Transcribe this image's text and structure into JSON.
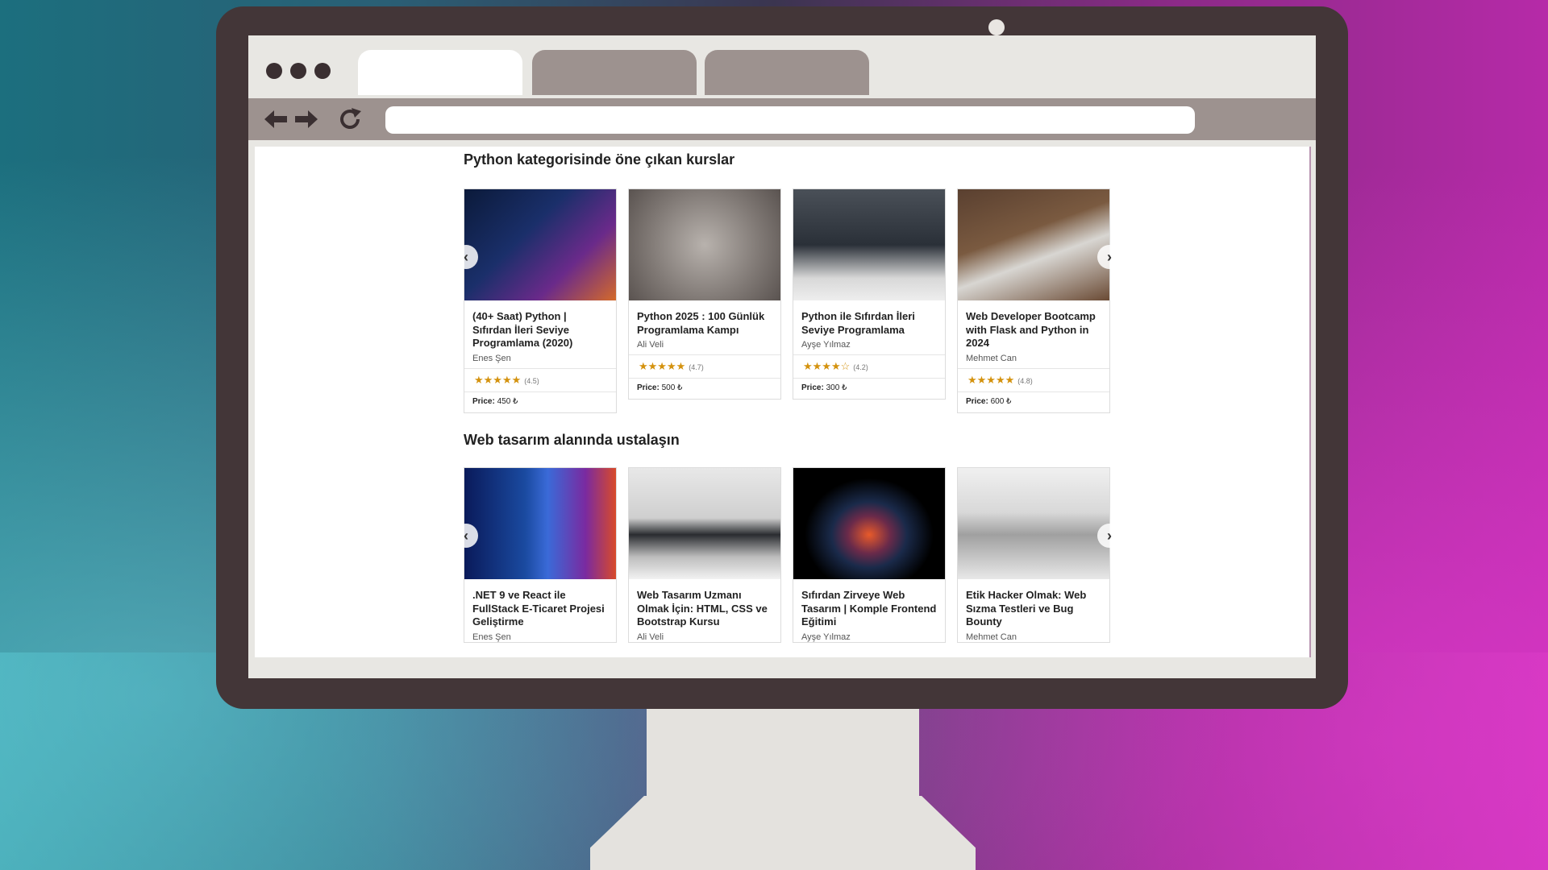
{
  "browser": {
    "tabs": [
      {
        "label": ""
      },
      {
        "label": ""
      },
      {
        "label": ""
      }
    ],
    "address_bar": {
      "value": "",
      "placeholder": ""
    },
    "icons": [
      "back-arrow-icon",
      "forward-arrow-icon",
      "reload-icon"
    ]
  },
  "sections": [
    {
      "title": "Python kategorisinde öne çıkan kurslar",
      "courses": [
        {
          "title": "(40+ Saat) Python | Sıfırdan İleri Seviye Programlama (2020)",
          "author": "Enes Şen",
          "stars": "★★★★★",
          "rating": "(4.5)",
          "price_label": "Price:",
          "price": "450 ₺"
        },
        {
          "title": "Python 2025 : 100 Günlük Programlama Kampı",
          "author": "Ali Veli",
          "stars": "★★★★★",
          "rating": "(4.7)",
          "price_label": "Price:",
          "price": "500 ₺"
        },
        {
          "title": "Python ile Sıfırdan İleri Seviye Programlama",
          "author": "Ayşe Yılmaz",
          "stars": "★★★★☆",
          "rating": "(4.2)",
          "price_label": "Price:",
          "price": "300 ₺"
        },
        {
          "title": "Web Developer Bootcamp with Flask and Python in 2024",
          "author": "Mehmet Can",
          "stars": "★★★★★",
          "rating": "(4.8)",
          "price_label": "Price:",
          "price": "600 ₺"
        }
      ]
    },
    {
      "title": "Web tasarım alanında ustalaşın",
      "courses": [
        {
          "title": ".NET 9 ve React ile FullStack E-Ticaret Projesi Geliştirme",
          "author": "Enes Şen"
        },
        {
          "title": "Web Tasarım Uzmanı Olmak İçin: HTML, CSS ve Bootstrap Kursu",
          "author": "Ali Veli"
        },
        {
          "title": "Sıfırdan Zirveye Web Tasarım | Komple Frontend Eğitimi",
          "author": "Ayşe Yılmaz"
        },
        {
          "title": "Etik Hacker Olmak: Web Sızma Testleri ve Bug Bounty",
          "author": "Mehmet Can"
        }
      ]
    }
  ],
  "carousel": {
    "prev": "‹",
    "next": "›"
  },
  "colors": {
    "star": "#d4920e",
    "monitor_frame": "#433638",
    "toolbar": "#9d928f"
  }
}
